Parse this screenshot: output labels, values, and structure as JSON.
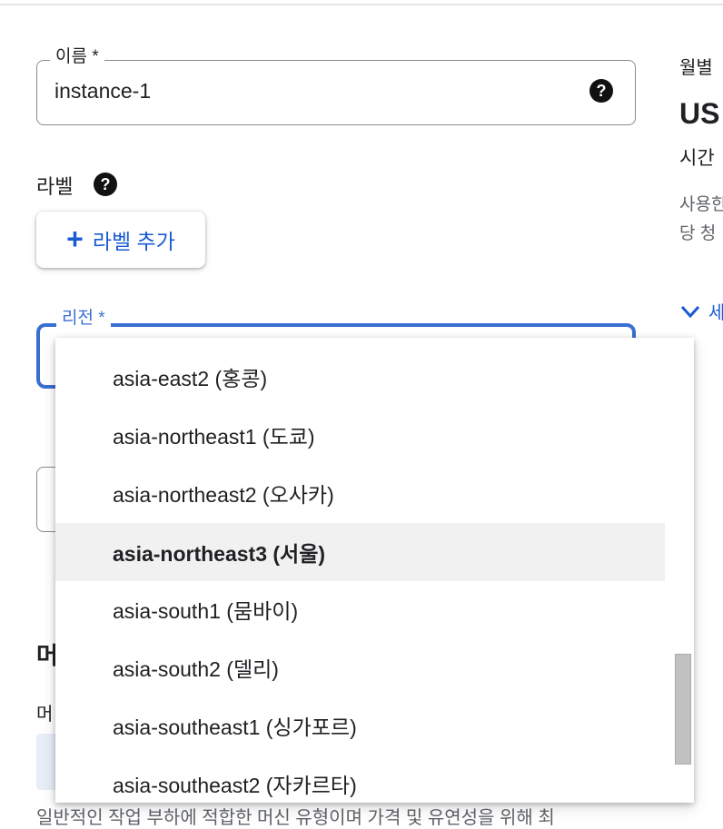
{
  "form": {
    "name": {
      "label": "이름 *",
      "value": "instance-1",
      "help_icon": "question-circle-icon"
    },
    "labels": {
      "title": "라벨",
      "help_icon": "question-circle-icon",
      "add_button_label": "라벨 추가",
      "add_icon": "plus-icon"
    },
    "region": {
      "label": "리전 *",
      "state": "focused"
    },
    "machine_config_fragments": {
      "title_fragment": "머",
      "subtitle_fragment": "머",
      "description": "일반적인 작업 부하에 적합한 머신 유형이며 가격 및 유연성을 위해 최"
    }
  },
  "pricing_panel": {
    "monthly_label": "월별",
    "price": "US",
    "hourly_text": "시간",
    "usage_line_1": "사용한",
    "usage_line_2": "당 청",
    "details_toggle": "세",
    "details_icon": "chevron-down-icon"
  },
  "region_dropdown": {
    "options": [
      {
        "label": "asia-east2 (홍콩)",
        "selected": false
      },
      {
        "label": "asia-northeast1 (도쿄)",
        "selected": false
      },
      {
        "label": "asia-northeast2 (오사카)",
        "selected": false
      },
      {
        "label": "asia-northeast3 (서울)",
        "selected": true
      },
      {
        "label": "asia-south1 (뭄바이)",
        "selected": false
      },
      {
        "label": "asia-south2 (델리)",
        "selected": false
      },
      {
        "label": "asia-southeast1 (싱가포르)",
        "selected": false
      },
      {
        "label": "asia-southeast2 (자카르타)",
        "selected": false
      }
    ]
  },
  "colors": {
    "accent": "#3a6fd2",
    "link": "#1a5bd3",
    "selected_row": "#f1f1f1",
    "scrollbar_thumb": "#c1c1c1"
  }
}
